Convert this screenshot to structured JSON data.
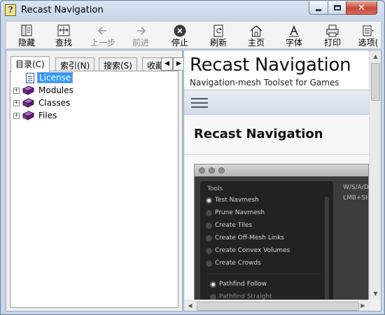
{
  "window": {
    "title": "Recast Navigation"
  },
  "toolbar": {
    "buttons": [
      {
        "label": "隐藏",
        "icon": "hide-icon",
        "enabled": true
      },
      {
        "label": "查找",
        "icon": "locate-icon",
        "enabled": true
      },
      {
        "label": "上一步",
        "icon": "back-arrow-icon",
        "enabled": false
      },
      {
        "label": "前进",
        "icon": "forward-arrow-icon",
        "enabled": false
      },
      {
        "label": "停止",
        "icon": "stop-icon",
        "enabled": true
      },
      {
        "label": "刷新",
        "icon": "refresh-icon",
        "enabled": true
      },
      {
        "label": "主页",
        "icon": "home-icon",
        "enabled": true
      },
      {
        "label": "字体",
        "icon": "font-icon",
        "enabled": true
      },
      {
        "label": "打印",
        "icon": "print-icon",
        "enabled": true
      },
      {
        "label": "选项(",
        "icon": "options-icon",
        "enabled": true
      }
    ]
  },
  "tabs": [
    {
      "label": "目录(C)",
      "active": true
    },
    {
      "label": "索引(N)",
      "active": false
    },
    {
      "label": "搜索(S)",
      "active": false
    },
    {
      "label": "收藏",
      "active": false
    }
  ],
  "tree": [
    {
      "label": "License",
      "icon": "page-icon",
      "expandable": false,
      "selected": true
    },
    {
      "label": "Modules",
      "icon": "book-icon",
      "expandable": true,
      "selected": false
    },
    {
      "label": "Classes",
      "icon": "book-icon",
      "expandable": true,
      "selected": false
    },
    {
      "label": "Files",
      "icon": "book-icon",
      "expandable": true,
      "selected": false
    }
  ],
  "doc": {
    "title": "Recast Navigation",
    "subtitle": "Navigation-mesh Toolset for Games",
    "content_title": "Recast Navigation",
    "screenshot": {
      "panel_heading": "Tools",
      "tools": [
        {
          "label": "Test Navmesh",
          "on": true
        },
        {
          "label": "Prune Navmesh",
          "on": false
        },
        {
          "label": "Create Tiles",
          "on": false
        },
        {
          "label": "Create Off-Mesh Links",
          "on": false
        },
        {
          "label": "Create Convex Volumes",
          "on": false
        },
        {
          "label": "Create Crowds",
          "on": false
        }
      ],
      "modes": [
        {
          "label": "Pathfind Follow",
          "on": true
        },
        {
          "label": "Pathfind Straight",
          "on": false
        }
      ],
      "hint_line1": "W/S/A/D",
      "hint_line2": "LMB+SH"
    }
  },
  "colors": {
    "selection": "#3399ff",
    "book": "#7b2d8e",
    "close_button": "#c6473a"
  }
}
